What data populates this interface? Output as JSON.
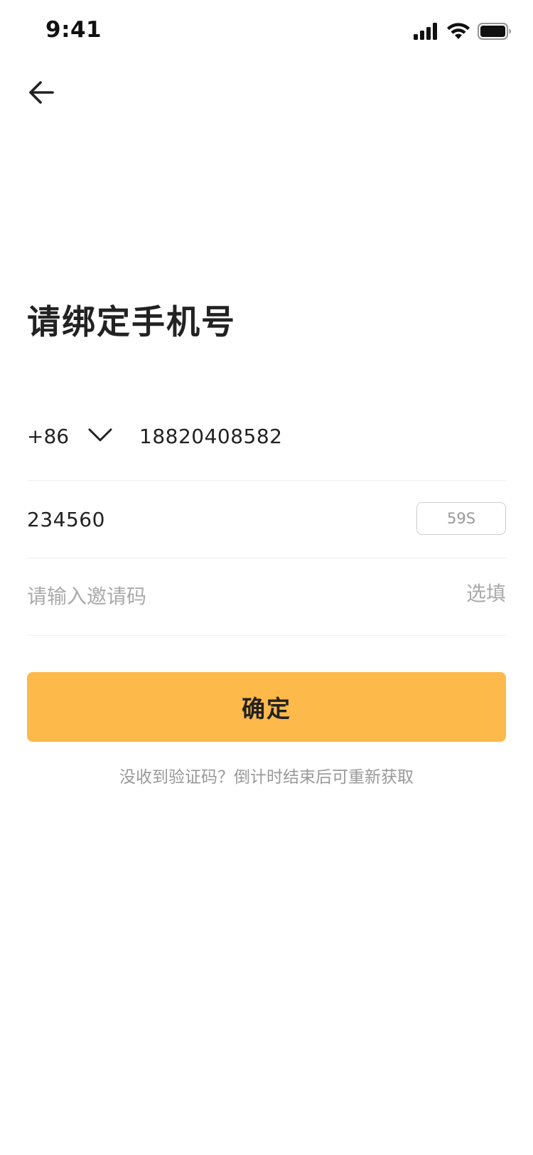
{
  "status_bar": {
    "time": "9:41",
    "icons": [
      "signal-icon",
      "wifi-icon",
      "battery-icon"
    ]
  },
  "nav": {
    "back_icon": "arrow-left-icon"
  },
  "title": "请绑定手机号",
  "phone": {
    "country_code": "+86",
    "dropdown_icon": "chevron-down-icon",
    "number": "18820408582"
  },
  "verification": {
    "code": "234560",
    "countdown_label": "59S"
  },
  "invite": {
    "placeholder": "请输入邀请码",
    "optional_label": "选填"
  },
  "confirm_label": "确定",
  "resend_tip": "没收到验证码？倒计时结束后可重新获取",
  "colors": {
    "accent": "#FDB94A",
    "text_primary": "#222222",
    "text_secondary": "#999999",
    "divider": "#eeeeee"
  }
}
